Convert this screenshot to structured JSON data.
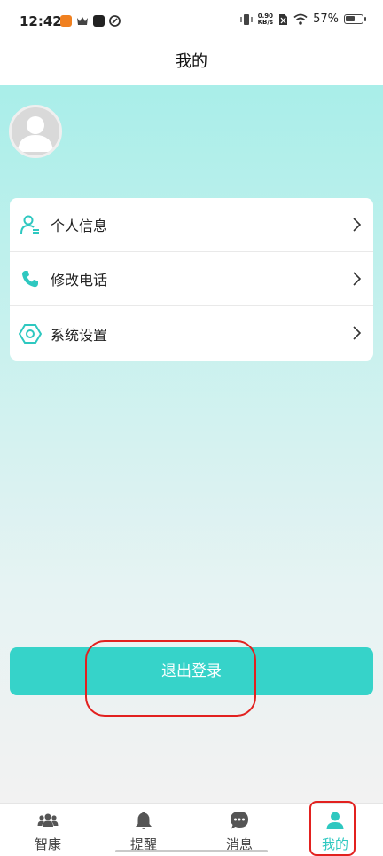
{
  "status_bar": {
    "time": "12:42",
    "net_speed_value": "0.90",
    "net_speed_unit": "KB/s",
    "battery_percent": "57%",
    "battery_level": 0.57
  },
  "header": {
    "title": "我的"
  },
  "menu": {
    "items": [
      {
        "label": "个人信息",
        "icon": "person-info-icon"
      },
      {
        "label": "修改电话",
        "icon": "phone-icon"
      },
      {
        "label": "系统设置",
        "icon": "settings-hexagon-icon"
      }
    ]
  },
  "logout": {
    "label": "退出登录"
  },
  "tabs": [
    {
      "label": "智康",
      "icon": "group-icon",
      "active": false
    },
    {
      "label": "提醒",
      "icon": "bell-icon",
      "active": false
    },
    {
      "label": "消息",
      "icon": "chat-bubble-icon",
      "active": false
    },
    {
      "label": "我的",
      "icon": "user-icon",
      "active": true
    }
  ],
  "colors": {
    "accent": "#2ec8c0",
    "button": "#36d3c9",
    "highlight_ring": "#e2211f"
  }
}
